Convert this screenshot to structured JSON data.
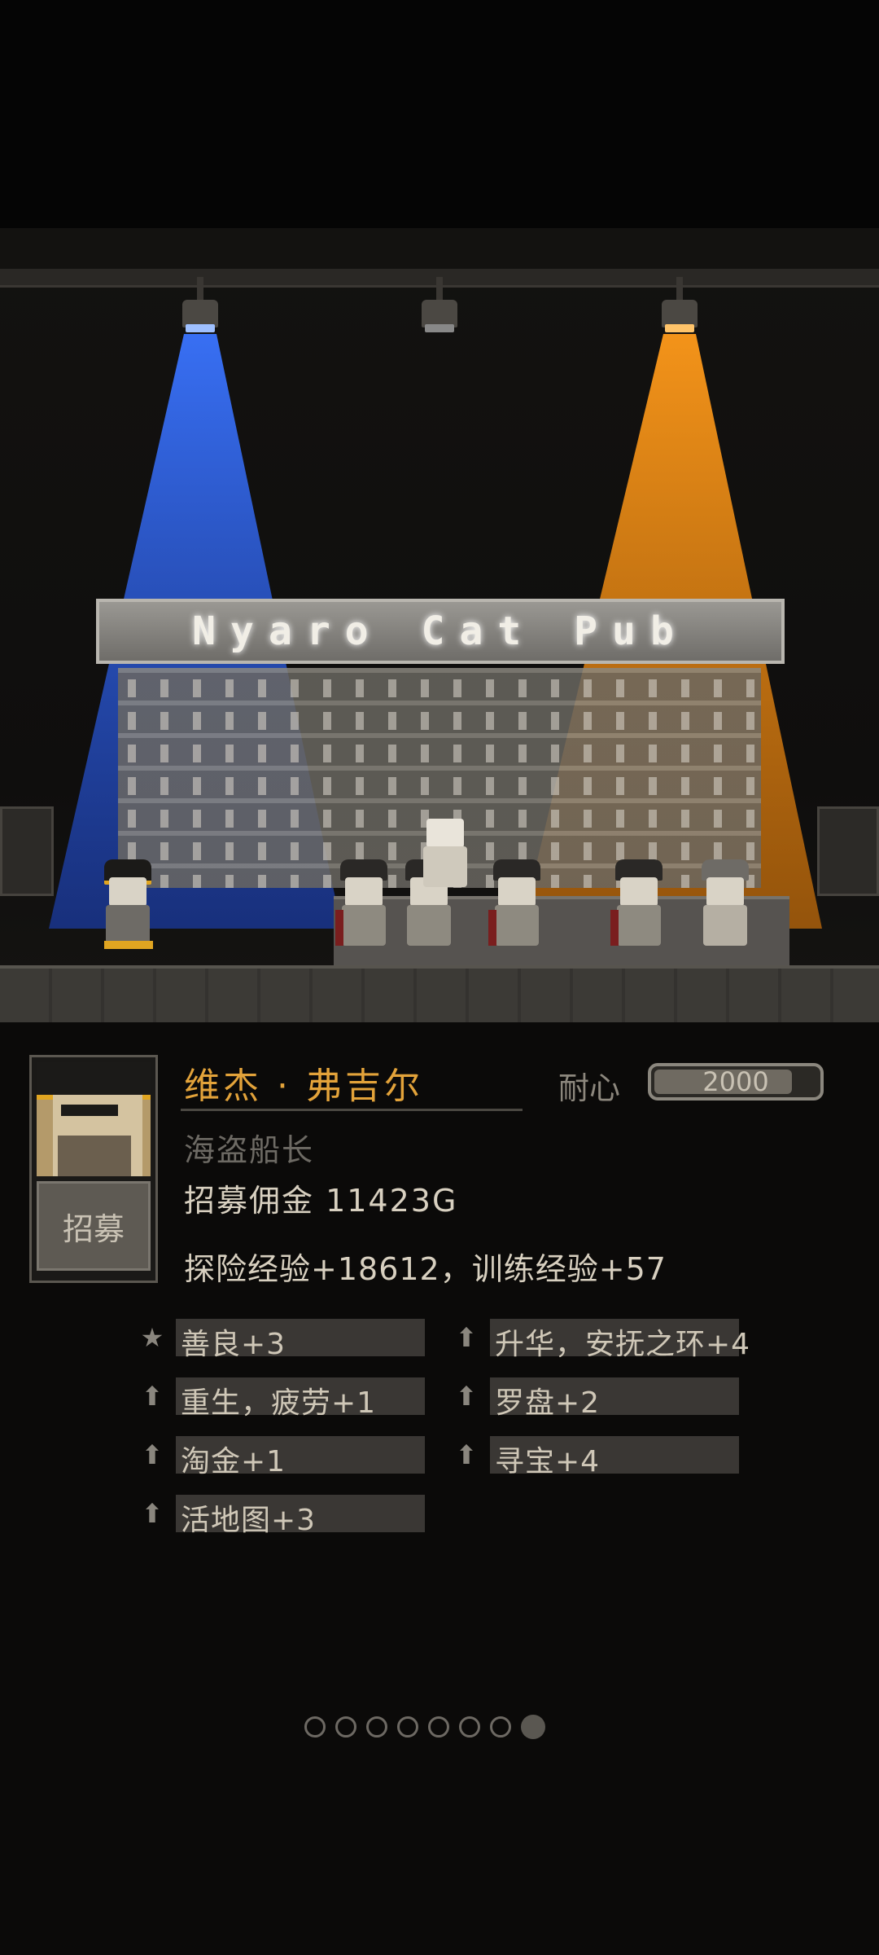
{
  "scene": {
    "sign_text": "Nyaro Cat Pub",
    "lights": {
      "left_color": "#2f5fd6",
      "center_color": "#777",
      "right_color": "#f08a10"
    }
  },
  "hero": {
    "name": "维杰 · 弗吉尔",
    "title": "海盗船长",
    "fee": "招募佣金 11423G",
    "experience": "探险经验+18612，训练经验+57",
    "recruit_label": "招募",
    "patience_label": "耐心",
    "patience_value": "2000",
    "patience_fraction": 0.85
  },
  "traits": [
    {
      "icon": "star-icon",
      "text": "善良+3"
    },
    {
      "icon": "up-arrow-icon",
      "text": "升华，安抚之环+4"
    },
    {
      "icon": "up-arrow-icon",
      "text": "重生，疲劳+1"
    },
    {
      "icon": "up-arrow-icon",
      "text": "罗盘+2"
    },
    {
      "icon": "up-arrow-icon",
      "text": "淘金+1"
    },
    {
      "icon": "up-arrow-icon",
      "text": "寻宝+4"
    },
    {
      "icon": "up-arrow-icon",
      "text": "活地图+3"
    }
  ],
  "pagination": {
    "total": 8,
    "active": 7
  },
  "colors": {
    "name": "#e3a33a",
    "panel_bg": "#0b0a09"
  }
}
